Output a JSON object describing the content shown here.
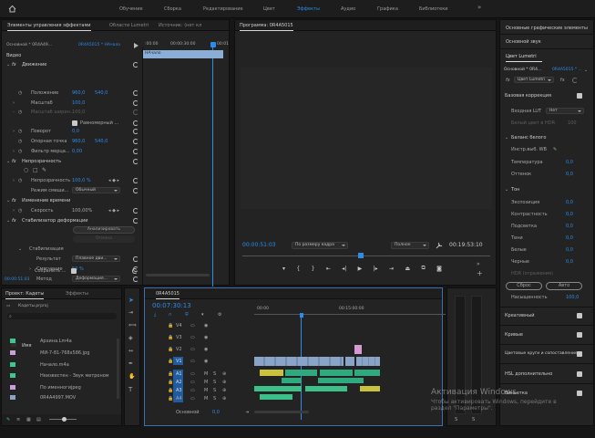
{
  "workspaces": [
    "Обучение",
    "Сборка",
    "Редактирование",
    "Цвет",
    "Эффекты",
    "Аудио",
    "Графика",
    "Библиотеки"
  ],
  "active_workspace": "Эффекты",
  "more_glyph": "»",
  "effects_panel": {
    "tabs": [
      "Элементы управления эффектами",
      "Области Lumetri",
      "Источник: (нет кл"
    ],
    "source_label": "Основной * 0R4A49...",
    "seq_label": "0R4A5015 * НАчало",
    "ruler_times": [
      ":00:00",
      "00:00:30:00",
      "00:01"
    ],
    "clip_name": "НАчало",
    "section_video": "Видео",
    "motion": "Движение",
    "pos_label": "Положение",
    "pos_x": "960,0",
    "pos_y": "540,0",
    "scale_label": "Масштаб",
    "scale_val": "100,0",
    "scale_w_label": "Масштаб ширин...",
    "scale_w_val": "100,0",
    "uniform_label": "Равномерный ...",
    "rot_label": "Поворот",
    "rot_val": "0,0",
    "anchor_label": "Опорная точка",
    "anchor_x": "960,0",
    "anchor_y": "540,0",
    "flicker_label": "Фильтр мерца...",
    "flicker_val": "0,00",
    "opacity": "Непрозрачность",
    "opacity_label": "Непрозрачность",
    "opacity_val": "100,0 %",
    "blend_label": "Режим смеши...",
    "blend_val": "Обычный",
    "time_remap": "Изменение времени",
    "speed_label": "Скорость",
    "speed_val": "100,00%",
    "stabilizer": "Стабилизатор деформации",
    "analyze_btn": "Анализировать",
    "cancel_btn": "Отмена",
    "stab_label": "Стабилизация",
    "result_label": "Результат",
    "result_val": "Плавное дви...",
    "smooth_label": "Смягчение",
    "smooth_val": "50 %",
    "method_label": "Метод",
    "method_val": "Деформация...",
    "save_label": "Сохранить ...",
    "timecode": "00:00:51:03"
  },
  "program": {
    "title": "Программа: 0R4A5015",
    "timecode_left": "00:00:51:03",
    "fit": "По размеру кадра",
    "quality": "Полное",
    "timecode_right": "00:19:53:10"
  },
  "project": {
    "tabs": [
      "Проект: Кадеты",
      "Эффекты"
    ],
    "file": "Кадеты.prproj",
    "col": "Имя",
    "items": [
      "Архина.Lm4a",
      "МИ-7-81-768x586.jpg",
      "Начало.m4a",
      "Неизвестен - Звук метроном",
      "По именногиjpeg",
      "0R4A4997.MOV"
    ],
    "colors": [
      "#3fc792",
      "#c9a0dc",
      "#3fc792",
      "#3fc792",
      "#c9a0dc",
      "#8aa4c8"
    ]
  },
  "timeline": {
    "tab": "0R4A5015",
    "timecode": "00:07:30:13",
    "ruler": [
      "00:00",
      "00:15:00:00"
    ],
    "tracks": [
      "V4",
      "V3",
      "V2",
      "V1",
      "A1",
      "A2",
      "A3",
      "A4"
    ],
    "master": "Основной",
    "master_val": "0,0"
  },
  "lumetri": {
    "essential_graphics": "Основные графические элементы",
    "essential_sound": "Основной звук",
    "color_title": "Цвет Lumetri",
    "src": "Основной * 0R4...",
    "seq": "0R4A5015 * ...",
    "fx": "fx",
    "fx_name": "Цвет Lumetri",
    "basic": "Базовая коррекция",
    "lut_label": "Входная LUT",
    "lut_val": "Нет",
    "hdr_label": "Белый цвет в HDR",
    "hdr_val": "100",
    "wb": "Баланс белого",
    "wb_picker": "Инстр.выб. WB",
    "temp": "Температура",
    "temp_v": "0,0",
    "tint": "Оттенок",
    "tint_v": "0,0",
    "tone": "Тон",
    "exposure": "Экспозиция",
    "exposure_v": "0,0",
    "contrast": "Контрастность",
    "contrast_v": "0,0",
    "highlights": "Подсветка",
    "highlights_v": "0,0",
    "shadows": "Тени",
    "shadows_v": "0,0",
    "whites": "Белые",
    "whites_v": "0,0",
    "blacks": "Черные",
    "blacks_v": "0,0",
    "hdr_spec": "HDR (отражения)",
    "reset_btn": "Сброс",
    "auto_btn": "Авто",
    "saturation": "Насыщенность",
    "saturation_v": "100,0",
    "creative": "Креативный",
    "curves": "Кривые",
    "wheels": "Цветовые круги и сопоставление",
    "hsl": "HSL дополнительно",
    "vignette": "Виньетка"
  },
  "watermark": {
    "title": "Активация Windows",
    "line1": "Чтобы активировать Windows, перейдите в",
    "line2": "раздел \"Параметры\"."
  }
}
